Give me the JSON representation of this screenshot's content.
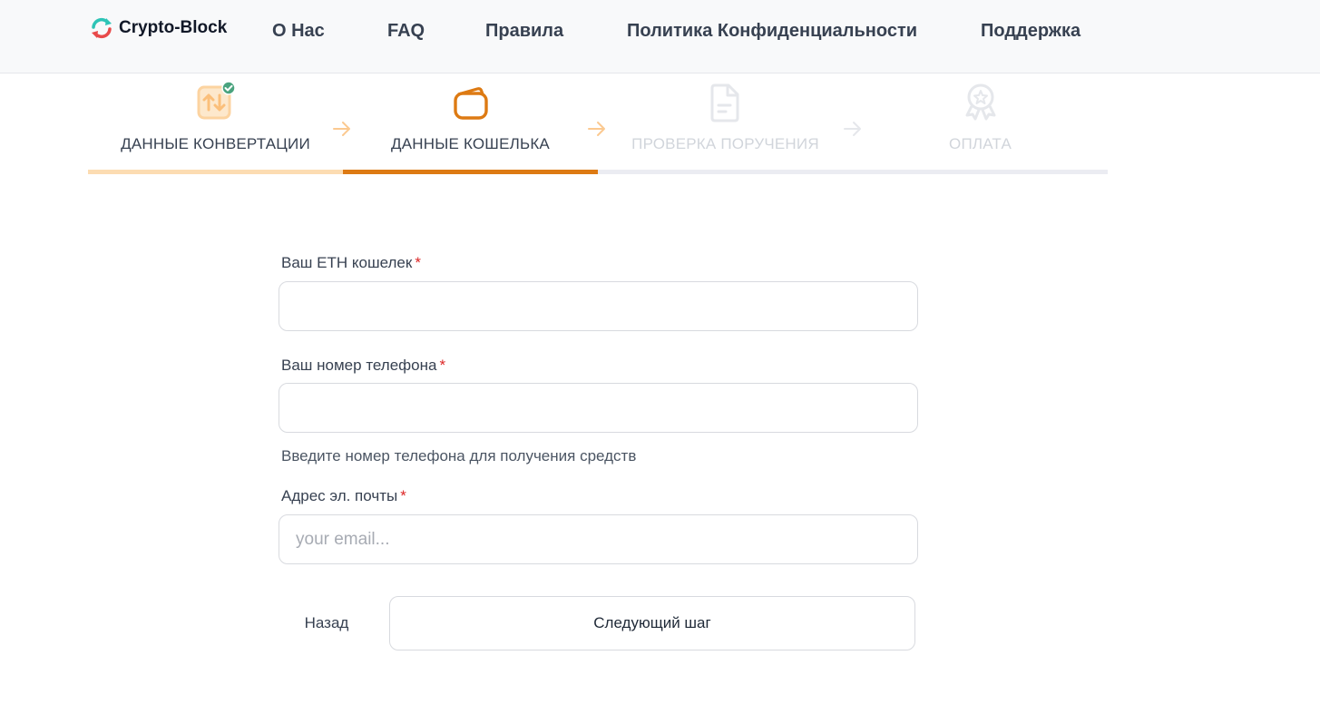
{
  "header": {
    "logo_text": "Crypto-Block",
    "nav": [
      {
        "label": "О Нас"
      },
      {
        "label": "FAQ"
      },
      {
        "label": "Правила"
      },
      {
        "label": "Политика Конфиденциальности"
      },
      {
        "label": "Поддержка"
      }
    ]
  },
  "stepper": {
    "steps": [
      {
        "label": "ДАННЫЕ КОНВЕРТАЦИИ",
        "state": "completed",
        "icon": "exchange-icon"
      },
      {
        "label": "ДАННЫЕ КОШЕЛЬКА",
        "state": "active",
        "icon": "wallet-icon"
      },
      {
        "label": "ПРОВЕРКА ПОРУЧЕНИЯ",
        "state": "pending",
        "icon": "document-icon"
      },
      {
        "label": "ОПЛАТА",
        "state": "pending",
        "icon": "award-icon"
      }
    ]
  },
  "form": {
    "eth_wallet": {
      "label": "Ваш ETH кошелек",
      "required_mark": "*",
      "value": "",
      "placeholder": ""
    },
    "phone": {
      "label": "Ваш номер телефона",
      "required_mark": "*",
      "value": "",
      "placeholder": "",
      "hint": "Введите номер телефона для получения средств"
    },
    "email": {
      "label": "Адрес эл. почты",
      "required_mark": "*",
      "value": "",
      "placeholder": "your email..."
    },
    "back_label": "Назад",
    "next_label": "Следующий шаг"
  },
  "colors": {
    "accent": "#dd7a13",
    "accent_light": "#fcdcb2",
    "pending": "#d1d5db",
    "check_badge": "#4aa37e",
    "logo_teal": "#2ec4b6",
    "logo_red": "#e84a4a"
  }
}
